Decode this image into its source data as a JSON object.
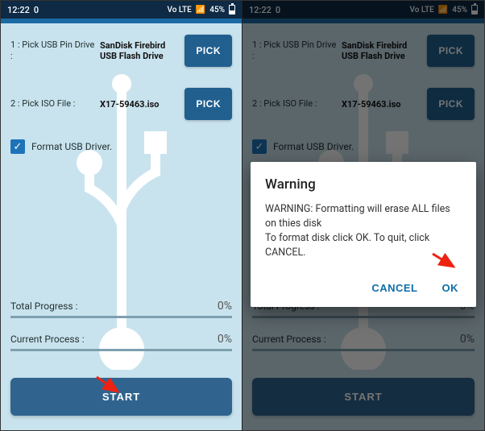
{
  "statusbar": {
    "time": "12:22",
    "net_label": "Vo LTE",
    "signal_pct": "45%",
    "kb_rate": "0"
  },
  "screen": {
    "row1_label": "1 : Pick USB Pin Drive :",
    "row1_value": "SanDisk Firebird USB Flash Drive",
    "row2_label": "2 : Pick ISO File :",
    "row2_value": "X17-59463.iso",
    "pick_btn": "PICK",
    "format_label": "Format USB Driver.",
    "format_checked": true,
    "total_label": "Total Progress :",
    "total_pct": "0%",
    "current_label": "Current Process :",
    "current_pct": "0%",
    "start_btn": "START"
  },
  "dialog": {
    "title": "Warning",
    "line1": "WARNING: Formatting will erase ALL files on thies disk",
    "line2": "To format disk click OK. To quit, click CANCEL.",
    "cancel": "CANCEL",
    "ok": "OK"
  }
}
